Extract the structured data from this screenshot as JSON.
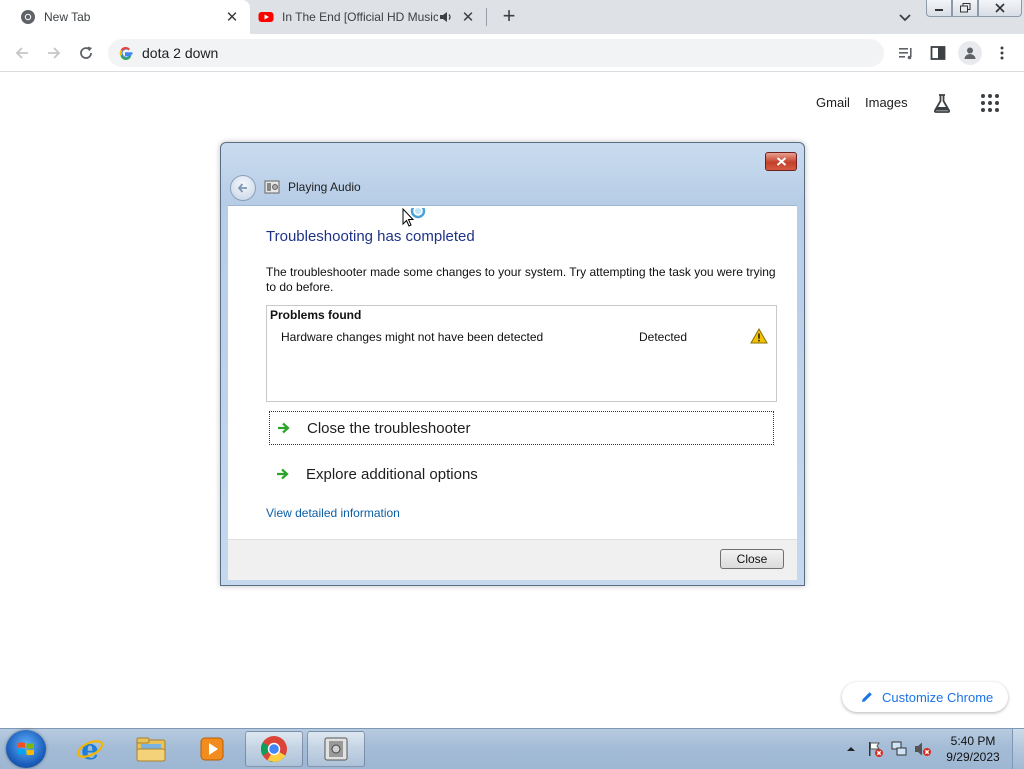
{
  "browser": {
    "tabs": [
      {
        "title": "New Tab",
        "icon": "chrome-icon",
        "active": true
      },
      {
        "title": "In The End [Official HD Music Video] - Linkin Park",
        "icon": "youtube-icon",
        "active": false,
        "audio": true
      }
    ],
    "omnibox": {
      "value": "dota 2 down"
    },
    "ntp": {
      "links": [
        "Gmail",
        "Images"
      ],
      "customize_label": "Customize Chrome"
    }
  },
  "dialog": {
    "title": "Playing Audio",
    "heading": "Troubleshooting has completed",
    "description": "The troubleshooter made some changes to your system. Try attempting the task you were trying to do before.",
    "problems": {
      "header": "Problems found",
      "items": [
        {
          "name": "Hardware changes might not have been detected",
          "status": "Detected",
          "icon": "warning-icon"
        }
      ]
    },
    "options": [
      {
        "label": "Close the troubleshooter",
        "focused": true
      },
      {
        "label": "Explore additional options",
        "focused": false
      }
    ],
    "detail_link": "View detailed information",
    "close_button": "Close"
  },
  "taskbar": {
    "apps": [
      "internet-explorer-icon",
      "file-explorer-icon",
      "media-player-icon",
      "chrome-icon",
      "troubleshooter-icon"
    ],
    "clock": {
      "time": "5:40 PM",
      "date": "9/29/2023"
    }
  },
  "colors": {
    "heading": "#1e3287",
    "link": "#0b5fa5",
    "chrome_accent": "#1a73e8",
    "warning": "#f2c200",
    "arrow_green": "#2aa52a"
  }
}
